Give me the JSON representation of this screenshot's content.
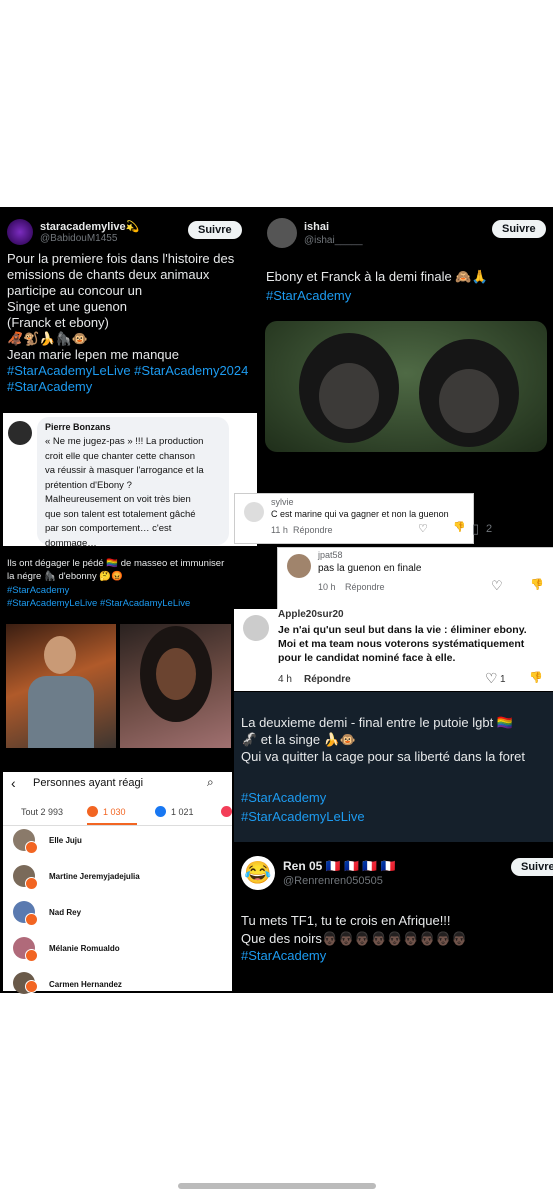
{
  "t1": {
    "name": "staracademylive💫",
    "handle": "@BabidouM1455",
    "follow": "Suivre",
    "text": "Pour la premiere fois dans l'histoire des\nemissions de chants deux animaux\nparticipe au concour un\nSinge et une guenon\n(Franck et ebony)\n🦧🐒🍌🦍🐵\nJean marie lepen me manque",
    "tags1": "#StarAcademyLeLive #StarAcademy2024",
    "tags2": "#StarAcademy"
  },
  "t2": {
    "name": "ishai",
    "handle": "@ishai_____",
    "follow": "Suivre",
    "text": "Ebony et Franck à la demi finale 🙈🙏",
    "tag": "#StarAcademy",
    "count": "2"
  },
  "fb": {
    "name": "Pierre Bonzans",
    "text": "« Ne me jugez-pas » !!! La production\ncroit elle que chanter cette chanson\nva réussir à masquer l'arrogance et la\nprétention d'Ebony ?\nMalheureusement on voit très bien\nque son talent est totalement gâché\npar son comportement… c'est\ndommage…"
  },
  "c_sylvie": {
    "name": "sylvie",
    "text": "C est marine qui va gagner et non la guenon",
    "time": "11 h",
    "reply": "Répondre"
  },
  "c_jpat": {
    "name": "jpat58",
    "text": "pas la guenon en finale",
    "time": "10 h",
    "reply": "Répondre"
  },
  "c_apple": {
    "name": "Apple20sur20",
    "text": "Je n'ai qu'un seul but dans la vie : éliminer ebony.\nMoi et ma team nous voterons systématiquement\npour le candidat nominé face à elle.",
    "time": "4 h",
    "reply": "Répondre",
    "likes": "1"
  },
  "ig": {
    "text": "Ils ont dégager le pédé 🏳️‍🌈 de masseo et immuniser\nla négre 🦍 d'ebonny 🤔😡",
    "tag1": "#StarAcademy",
    "tag2": "#StarAcademyLeLive #StarAcadamyLeLive"
  },
  "t3": {
    "text": "La deuxieme demi - final entre le putoie lgbt 🏳️‍🌈\n🦨 et la singe 🍌🐵\nQui va quitter la cage pour sa liberté dans la foret",
    "tag1": "#StarAcademy",
    "tag2": "#StarAcademyLeLive"
  },
  "reactions": {
    "title": "Personnes ayant réagi",
    "tab_all": "Tout 2 993",
    "tab_angry": "1 030",
    "tab_like": "1 021",
    "people": [
      "Elle Juju",
      "Martine Jeremyjadejulia",
      "Nad Rey",
      "Mélanie Romualdo",
      "Carmen Hernandez"
    ]
  },
  "t4": {
    "name": "Ren 05 🇫🇷 🇫🇷 🇫🇷 🇫🇷",
    "handle": "@Renrenren050505",
    "follow": "Suivre",
    "text": "Tu mets TF1, tu te crois en Afrique!!!\nQue des noirs👨🏿👨🏿👨🏿👨🏿👨🏿👨🏿👨🏿👨🏿👨🏿",
    "tag": "#StarAcademy"
  },
  "colors": {
    "link": "#1d9bf0",
    "angry": "#f26522",
    "like": "#1877f2"
  }
}
